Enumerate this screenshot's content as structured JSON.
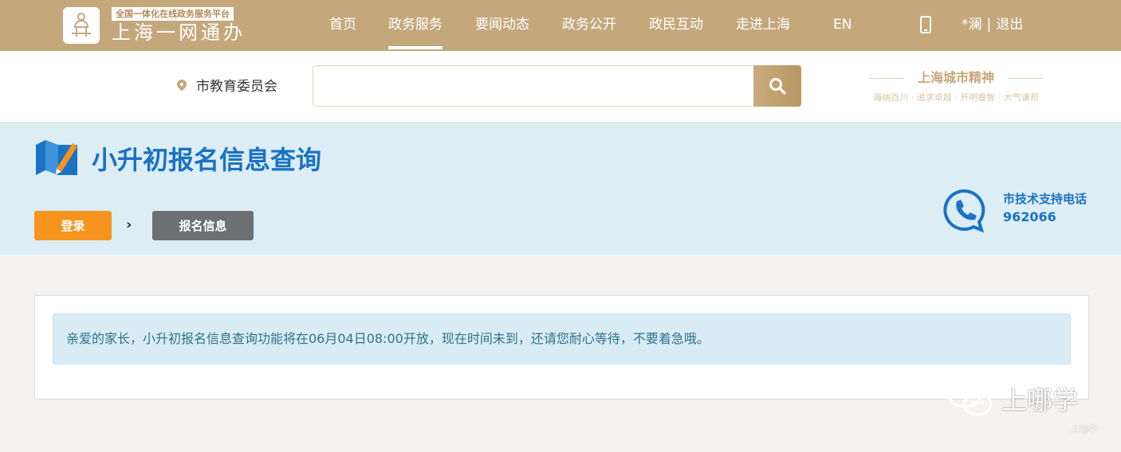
{
  "header": {
    "slogan": "全国一体化在线政务服务平台",
    "brand": "上海一网通办",
    "nav": [
      {
        "label": "首页"
      },
      {
        "label": "政务服务"
      },
      {
        "label": "要闻动态"
      },
      {
        "label": "政务公开"
      },
      {
        "label": "政民互动"
      },
      {
        "label": "走进上海"
      },
      {
        "label": "EN"
      }
    ],
    "active_nav": "政务服务",
    "user_name": "*澜",
    "separator": "|",
    "logout": "退出"
  },
  "search": {
    "location": "市教育委员会",
    "value": "",
    "placeholder": ""
  },
  "city_spirit": {
    "title": "上海城市精神",
    "subtitle": "海纳百川 · 追求卓越 · 开明睿智 · 大气谦和"
  },
  "banner": {
    "title": "小升初报名信息查询",
    "steps": [
      {
        "label": "登录"
      },
      {
        "label": "报名信息"
      }
    ],
    "support_label": "市技术支持电话",
    "support_number": "962066"
  },
  "notice": {
    "text": "亲爱的家长，小升初报名信息查询功能将在06月04日08:00开放，现在时间未到，还请您耐心等待，不要着急哦。"
  },
  "watermark": {
    "account": "上哪学",
    "small": "上哪学"
  },
  "colors": {
    "header_bg": "#c4a87c",
    "banner_bg": "#dcedf6",
    "title_blue": "#1a72c3",
    "step_login": "#f7941d",
    "step_info": "#6c7073",
    "notice_bg": "#d9ecf6",
    "notice_text": "#31708f"
  },
  "icons": [
    "logo-icon",
    "phone-icon",
    "location-icon",
    "search-icon",
    "edit-book-icon",
    "chevron-right-icon",
    "support-phone-icon",
    "wechat-icon"
  ]
}
